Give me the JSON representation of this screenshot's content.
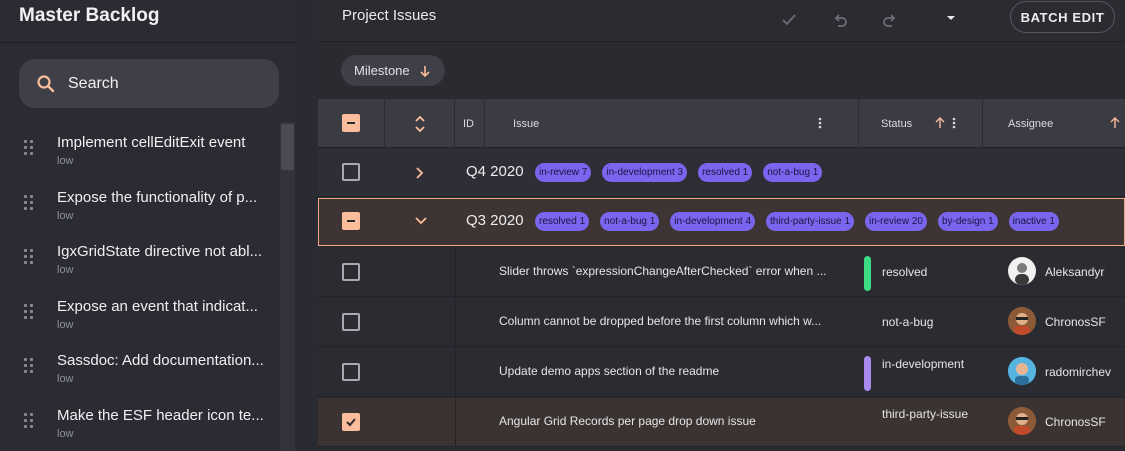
{
  "backlog": {
    "title": "Master Backlog",
    "search_placeholder": "Search",
    "items": [
      {
        "title": "Implement cellEditExit event",
        "priority": "low"
      },
      {
        "title": "Expose the functionality of p...",
        "priority": "low"
      },
      {
        "title": "IgxGridState directive not abl...",
        "priority": "low"
      },
      {
        "title": "Expose an event that indicat...",
        "priority": "low"
      },
      {
        "title": "Sassdoc: Add documentation...",
        "priority": "low"
      },
      {
        "title": "Make the ESF header icon te...",
        "priority": "low"
      }
    ]
  },
  "toolbar": {
    "title": "Project Issues",
    "batch_edit_label": "BATCH EDIT",
    "icons": [
      "check-icon",
      "undo-icon",
      "redo-icon",
      "caret-down-icon"
    ]
  },
  "groupby": {
    "chip_label": "Milestone"
  },
  "columns": {
    "id": "ID",
    "issue": "Issue",
    "status": "Status",
    "assignee": "Assignee"
  },
  "groups": [
    {
      "label": "Q4 2020",
      "expanded": false,
      "chips": [
        "in-review 7",
        "in-development 3",
        "resolved 1",
        "not-a-bug 1"
      ]
    },
    {
      "label": "Q3 2020",
      "expanded": true,
      "chips": [
        "resolved 1",
        "not-a-bug 1",
        "in-development 4",
        "third-party-issue 1",
        "in-review 20",
        "by-design 1",
        "inactive 1"
      ]
    }
  ],
  "rows": [
    {
      "issue": "Slider throws `expressionChangeAfterChecked` error when ...",
      "status": "resolved",
      "status_color": "#3ddc84",
      "assignee": "Aleksandyr",
      "selected": false
    },
    {
      "issue": "Column cannot be dropped before the first column which w...",
      "status": "not-a-bug",
      "status_color": "",
      "assignee": "ChronosSF",
      "selected": false
    },
    {
      "issue": "Update demo apps section of the readme",
      "status": "in-development",
      "status_color": "#a98bf0",
      "assignee": "radomirchev",
      "selected": false
    },
    {
      "issue": "Angular Grid Records per page drop down issue",
      "status": "third-party-issue",
      "status_color": "",
      "assignee": "ChronosSF",
      "selected": true
    }
  ],
  "colors": {
    "accent": "#fcbd9c",
    "chip": "#7a65ee"
  }
}
